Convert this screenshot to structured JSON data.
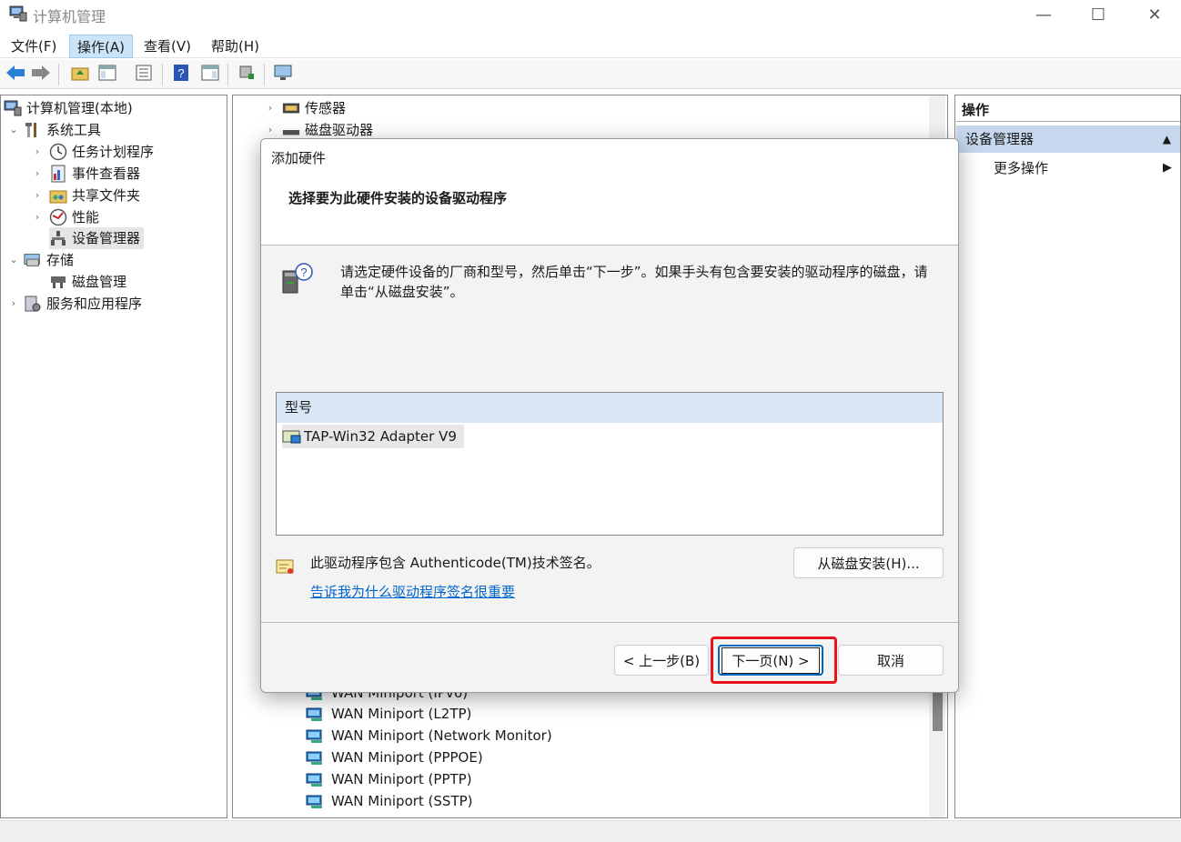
{
  "window": {
    "title": "计算机管理"
  },
  "menu": {
    "items": [
      "文件(F)",
      "操作(A)",
      "查看(V)",
      "帮助(H)"
    ],
    "active_index": 1
  },
  "tree": {
    "root": "计算机管理(本地)",
    "system_tools": "系统工具",
    "task_scheduler": "任务计划程序",
    "event_viewer": "事件查看器",
    "shared_folders": "共享文件夹",
    "performance": "性能",
    "device_manager": "设备管理器",
    "storage": "存储",
    "disk_management": "磁盘管理",
    "services_apps": "服务和应用程序"
  },
  "middle": {
    "top_items": [
      "传感器",
      "磁盘驱动器"
    ],
    "bottom_items": [
      "WAN Miniport (IPv6)",
      "WAN Miniport (L2TP)",
      "WAN Miniport (Network Monitor)",
      "WAN Miniport (PPPOE)",
      "WAN Miniport (PPTP)",
      "WAN Miniport (SSTP)"
    ]
  },
  "actions": {
    "header": "操作",
    "section": "设备管理器",
    "more": "更多操作"
  },
  "dialog": {
    "title": "添加硬件",
    "heading": "选择要为此硬件安装的设备驱动程序",
    "instruction": "请选定硬件设备的厂商和型号，然后单击“下一步”。如果手头有包含要安装的驱动程序的磁盘，请单击“从磁盘安装”。",
    "model_header": "型号",
    "model_item": "TAP-Win32 Adapter V9",
    "signature_text": "此驱动程序包含 Authenticode(TM)技术签名。",
    "signature_link": "告诉我为什么驱动程序签名很重要",
    "have_disk": "从磁盘安装(H)...",
    "back": "< 上一步(B)",
    "next": "下一页(N) >",
    "cancel": "取消"
  },
  "colors": {
    "highlight": "#e8141b",
    "link": "#0066cc",
    "selection": "#cce4f7"
  }
}
